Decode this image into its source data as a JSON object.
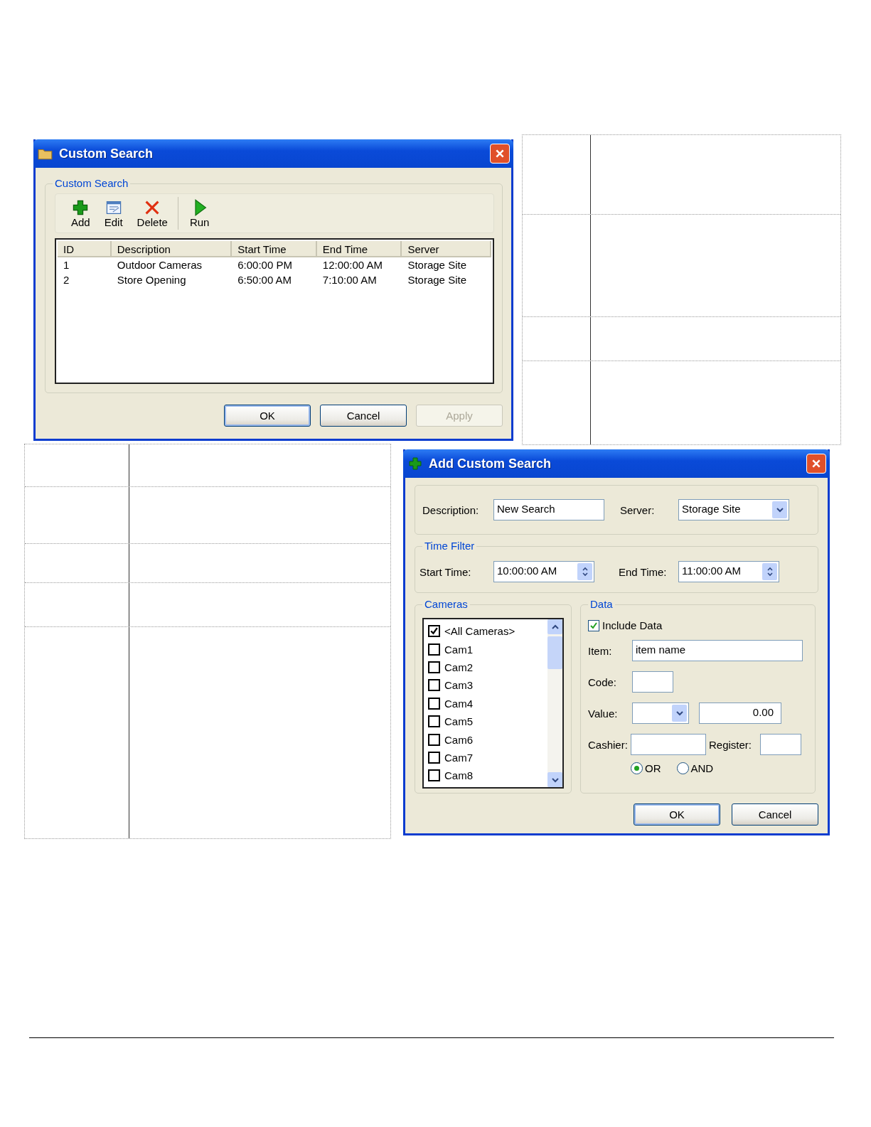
{
  "custom_search_dialog": {
    "title": "Custom Search",
    "group_label": "Custom Search",
    "toolbar": [
      {
        "label": "Add",
        "kind": "add"
      },
      {
        "label": "Edit",
        "kind": "edit"
      },
      {
        "label": "Delete",
        "kind": "delete"
      },
      {
        "label": "Run",
        "kind": "run"
      }
    ],
    "table": {
      "columns": [
        "ID",
        "Description",
        "Start Time",
        "End Time",
        "Server"
      ],
      "rows": [
        [
          "1",
          "Outdoor Cameras",
          "6:00:00 PM",
          "12:00:00 AM",
          "Storage Site"
        ],
        [
          "2",
          "Store Opening",
          "6:50:00 AM",
          "7:10:00 AM",
          "Storage Site"
        ]
      ]
    },
    "buttons": [
      {
        "label": "OK",
        "disabled": false,
        "default": true
      },
      {
        "label": "Cancel",
        "disabled": false,
        "default": false
      },
      {
        "label": "Apply",
        "disabled": true,
        "default": false
      }
    ]
  },
  "add_custom_search_dialog": {
    "title": "Add Custom Search",
    "description": {
      "label": "Description:",
      "value": "New Search"
    },
    "server": {
      "label": "Server:",
      "value": "Storage Site"
    },
    "time_filter": {
      "label": "Time Filter",
      "start": {
        "label": "Start Time:",
        "value": "10:00:00 AM"
      },
      "end": {
        "label": "End Time:",
        "value": "11:00:00 AM"
      }
    },
    "cameras": {
      "label": "Cameras",
      "items": [
        {
          "label": "<All Cameras>",
          "checked": true
        },
        {
          "label": "Cam1",
          "checked": false
        },
        {
          "label": "Cam2",
          "checked": false
        },
        {
          "label": "Cam3",
          "checked": false
        },
        {
          "label": "Cam4",
          "checked": false
        },
        {
          "label": "Cam5",
          "checked": false
        },
        {
          "label": "Cam6",
          "checked": false
        },
        {
          "label": "Cam7",
          "checked": false
        },
        {
          "label": "Cam8",
          "checked": false
        }
      ]
    },
    "data": {
      "label": "Data",
      "include_data": {
        "label": "Include Data",
        "checked": true
      },
      "item": {
        "label": "Item:",
        "value": "item name"
      },
      "code": {
        "label": "Code:"
      },
      "value": {
        "label": "Value:",
        "amount": "0.00"
      },
      "cashier": {
        "label": "Cashier:"
      },
      "register": {
        "label": "Register:"
      },
      "logic": [
        {
          "label": "OR",
          "selected": true
        },
        {
          "label": "AND",
          "selected": false
        }
      ]
    },
    "buttons": [
      {
        "label": "OK",
        "default": true
      },
      {
        "label": "Cancel",
        "default": false
      }
    ]
  }
}
